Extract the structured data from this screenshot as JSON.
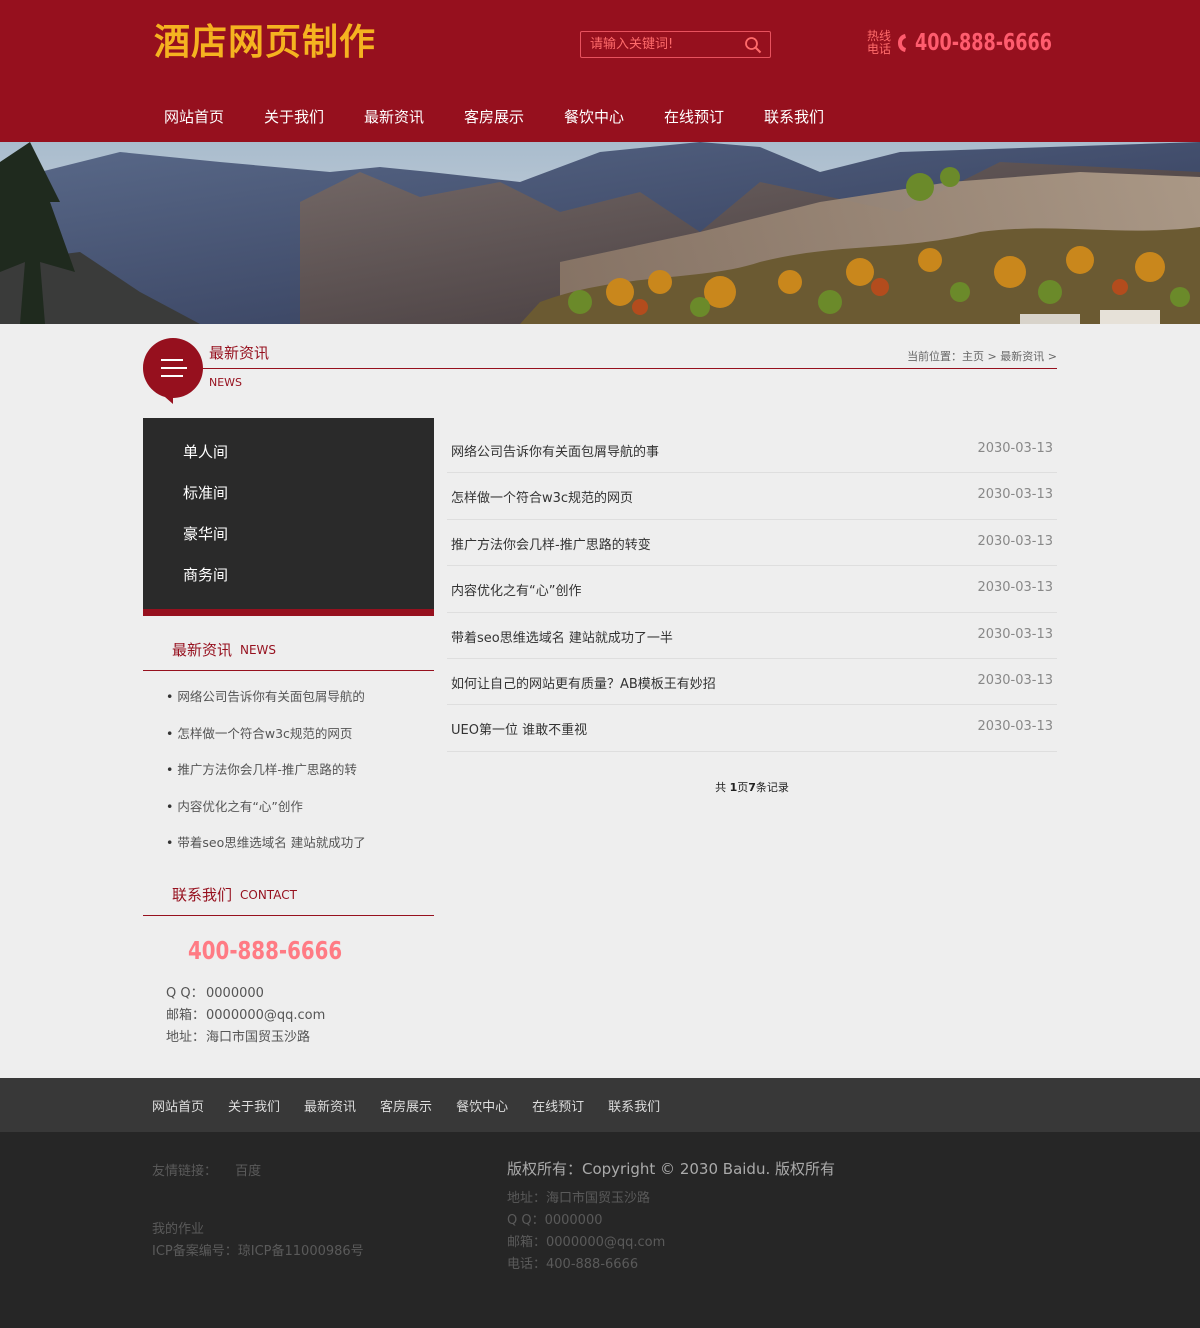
{
  "header": {
    "logo": "酒店网页制作",
    "search_placeholder": "请输入关键词!",
    "hotline_label": "热线电话",
    "hotline_number": "400-888-6666",
    "colors": {
      "brand": "#96101e",
      "logo": "#f5b320",
      "accent": "#ff5c6e"
    }
  },
  "nav": {
    "items": [
      "网站首页",
      "关于我们",
      "最新资讯",
      "客房展示",
      "餐饮中心",
      "在线预订",
      "联系我们"
    ]
  },
  "section": {
    "title_cn": "最新资讯",
    "title_en": "NEWS",
    "breadcrumb": "当前位置：主页 > 最新资讯 >"
  },
  "sidebar": {
    "menu": [
      "单人间",
      "标准间",
      "豪华间",
      "商务间"
    ],
    "news_title_cn": "最新资讯",
    "news_title_en": "NEWS",
    "news": [
      "网络公司告诉你有关面包屑导航的",
      "怎样做一个符合w3c规范的网页",
      "推广方法你会几样-推广思路的转",
      "内容优化之有“心”创作",
      "带着seo思维选域名 建站就成功了"
    ],
    "contact_title_cn": "联系我们",
    "contact_title_en": "CONTACT",
    "contact_phone": "400-888-6666",
    "qq_label": "Q Q：",
    "qq": "0000000",
    "email_label": "邮箱：",
    "email": "0000000@qq.com",
    "address_label": "地址：",
    "address": "海口市国贸玉沙路"
  },
  "news_list": [
    {
      "title": "网络公司告诉你有关面包屑导航的事",
      "date": "2030-03-13"
    },
    {
      "title": "怎样做一个符合w3c规范的网页",
      "date": "2030-03-13"
    },
    {
      "title": "推广方法你会几样-推广思路的转变",
      "date": "2030-03-13"
    },
    {
      "title": "内容优化之有“心”创作",
      "date": "2030-03-13"
    },
    {
      "title": "带着seo思维选域名 建站就成功了一半",
      "date": "2030-03-13"
    },
    {
      "title": "如何让自己的网站更有质量？AB模板王有妙招",
      "date": "2030-03-13"
    },
    {
      "title": "UEO第一位 谁敢不重视",
      "date": "2030-03-13"
    }
  ],
  "pager": {
    "prefix": "共 ",
    "pages": "1",
    "mid": "页",
    "records": "7",
    "suffix": "条记录"
  },
  "footer_nav": [
    "网站首页",
    "关于我们",
    "最新资讯",
    "客房展示",
    "餐饮中心",
    "在线预订",
    "联系我们"
  ],
  "footer": {
    "links_label": "友情链接：",
    "link_baidu": "百度",
    "homework": "我的作业",
    "icp": "ICP备案编号：琼ICP备11000986号",
    "copyright": "版权所有：Copyright © 2030 Baidu. 版权所有",
    "address": "地址：海口市国贸玉沙路",
    "qq": "Q Q：0000000",
    "email": "邮箱：0000000@qq.com",
    "phone": "电话：400-888-6666"
  }
}
